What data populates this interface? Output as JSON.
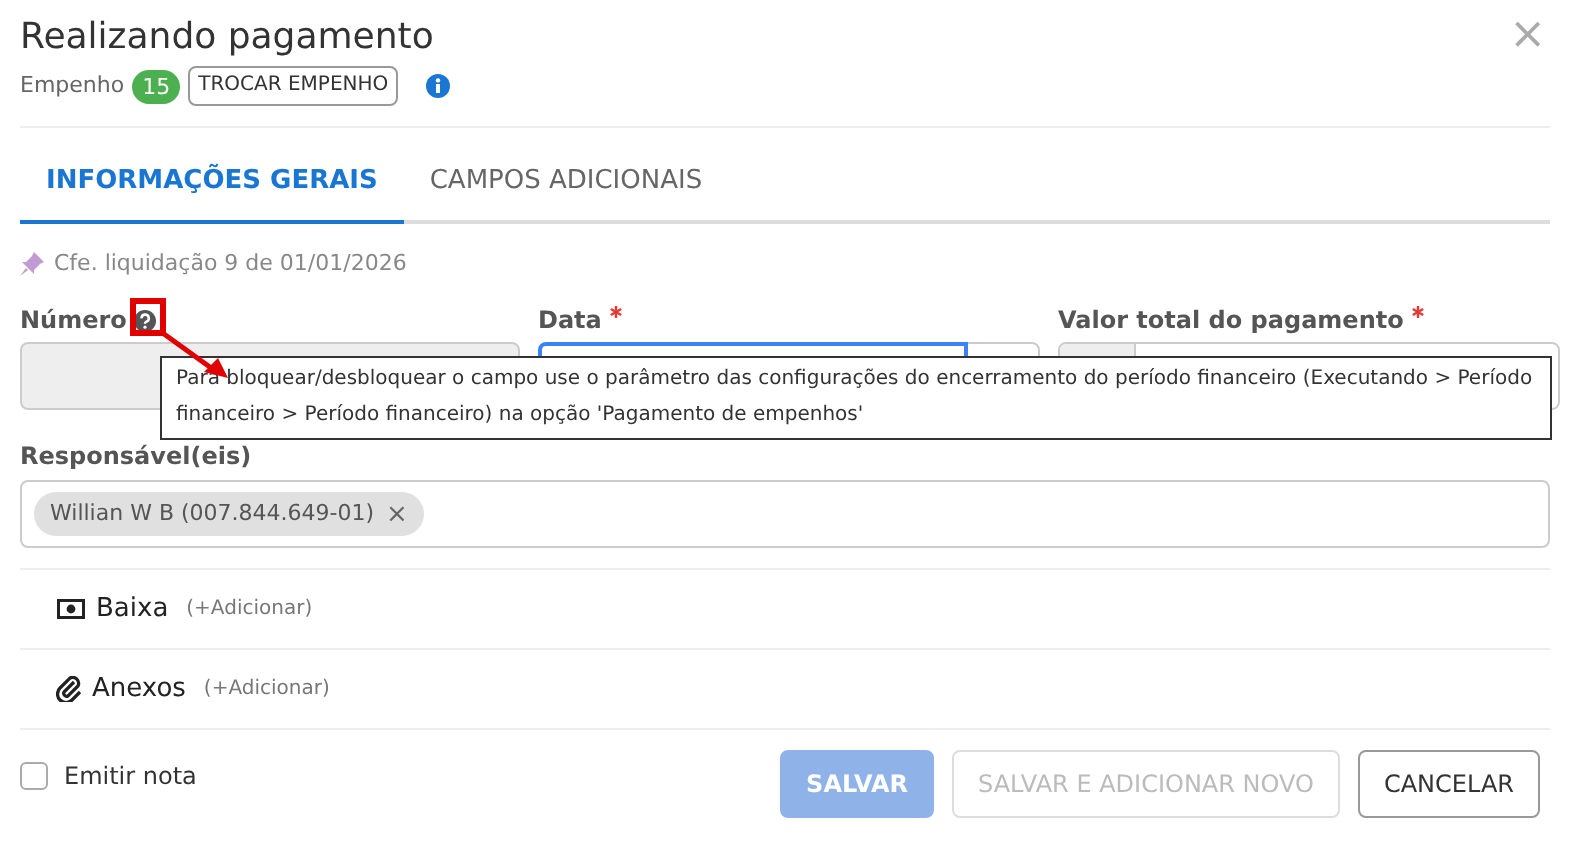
{
  "dialog": {
    "title": "Realizando pagamento",
    "close": "×"
  },
  "empenho": {
    "label": "Empenho",
    "count": "15",
    "change_button": "TROCAR EMPENHO"
  },
  "tabs": [
    {
      "label": "INFORMAÇÕES GERAIS",
      "selected": true
    },
    {
      "label": "CAMPOS ADICIONAIS",
      "selected": false
    }
  ],
  "reference": "Cfe. liquidação 9 de 01/01/2026",
  "fields": [
    {
      "label": "Número",
      "required": false,
      "help": true,
      "disabled": true
    },
    {
      "label": "Data",
      "required": true,
      "help": false,
      "focused": true
    },
    {
      "label": "Valor total do pagamento",
      "required": true,
      "help": false
    }
  ],
  "tooltip": "Para bloquear/desbloquear o campo use o parâmetro das configurações do encerramento do período financeiro (Executando > Período financeiro > Período financeiro) na opção 'Pagamento de empenhos'",
  "responsible": {
    "label": "Responsável(eis)",
    "chips": [
      {
        "text": "Willian W B (007.844.649-01)",
        "remove": "×"
      }
    ]
  },
  "sections": [
    {
      "kind": "money",
      "title": "Baixa",
      "action": "(+Adicionar)"
    },
    {
      "kind": "attachment",
      "title": "Anexos",
      "action": "(+Adicionar)"
    }
  ],
  "footer": {
    "checkbox": {
      "label": "Emitir nota",
      "checked": false
    },
    "buttons": [
      {
        "label": "SALVAR",
        "kind": "primary",
        "disabled": true
      },
      {
        "label": "SALVAR E ADICIONAR NOVO",
        "kind": "outline",
        "disabled": true
      },
      {
        "label": "CANCELAR",
        "kind": "outline",
        "disabled": false
      }
    ]
  }
}
